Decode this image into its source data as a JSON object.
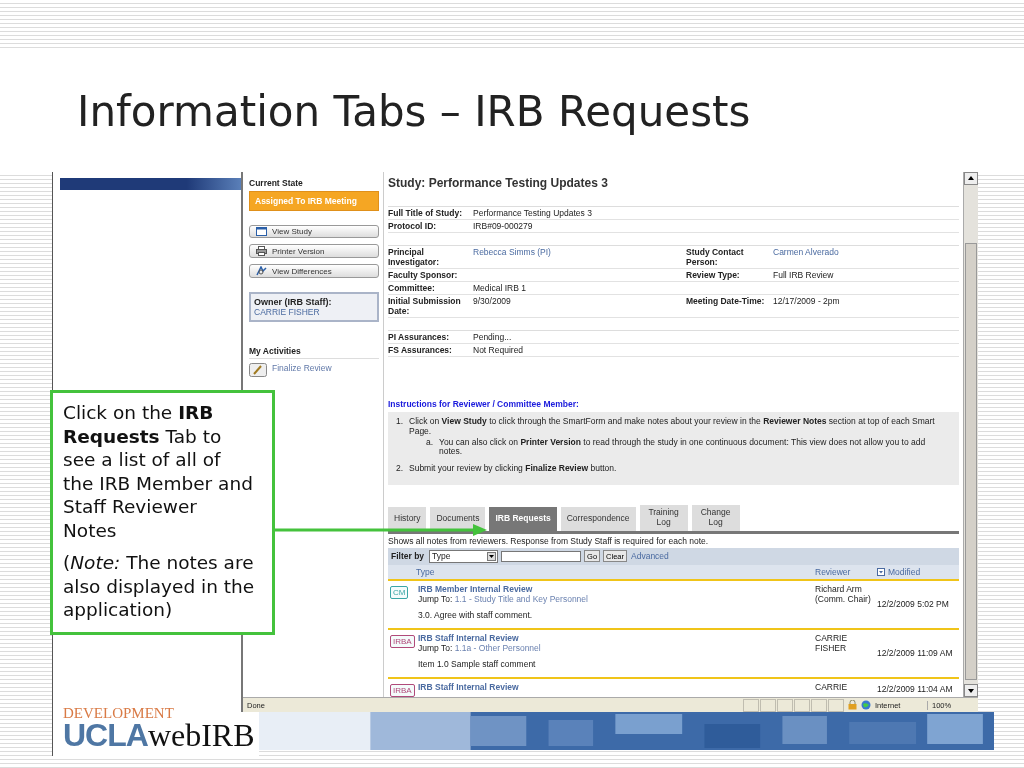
{
  "slide": {
    "title": "Information Tabs – IRB Requests"
  },
  "sidebar": {
    "state_label": "Current State",
    "state": "Assigned To IRB Meeting",
    "buttons": [
      {
        "label": "View Study",
        "kind": "window"
      },
      {
        "label": "Printer Version",
        "kind": "printer"
      },
      {
        "label": "View Differences",
        "kind": "compare"
      }
    ],
    "owner_label": "Owner (IRB Staff):",
    "owner": "CARRIE FISHER",
    "activities_label": "My Activities",
    "activities": [
      {
        "label": "Finalize Review",
        "kind": "pencil"
      }
    ]
  },
  "study": {
    "heading": "Study:  Performance Testing Updates 3",
    "groups": [
      [
        {
          "label": "Full Title of Study:",
          "value": "Performance Testing Updates 3",
          "is_link": false
        },
        {
          "label": "Protocol ID:",
          "value": "IRB#09-000279",
          "is_link": false
        }
      ],
      [
        {
          "label": "Principal Investigator:",
          "value": "Rebecca Simms (PI)",
          "is_link": true,
          "label_2": "Study Contact Person:",
          "value_2": "Carmen Alverado",
          "is_link_2": true
        },
        {
          "label": "Faculty Sponsor:",
          "label_2": "Review Type:",
          "value_2": "Full IRB Review",
          "is_link_2": false
        },
        {
          "label": "Committee:",
          "value": "Medical IRB 1",
          "is_link": false
        },
        {
          "label": "Initial Submission Date:",
          "value": "9/30/2009",
          "is_link": false,
          "label_2": "Meeting Date-Time:",
          "value_2": "12/17/2009 - 2pm",
          "is_link_2": false
        }
      ],
      [
        {
          "label": "PI Assurances:",
          "value": "Pending...",
          "is_link": false
        },
        {
          "label": "FS Assurances:",
          "value": "Not Required",
          "is_link": false
        }
      ]
    ]
  },
  "instructions": {
    "title": "Instructions for Reviewer / Committee Member:",
    "items": [
      {
        "marker": "1.",
        "text": "Click on **View Study** to click through the SmartForm and make notes about your review in the **Reviewer Notes** section at top of each Smart Page.",
        "children": [
          {
            "marker": "a.",
            "text": "You can also click on **Printer Version** to read through the study in one continuous document: This view does not allow you to add notes."
          }
        ]
      },
      {
        "marker": "2.",
        "text": "Submit your review by clicking **Finalize Review** button."
      }
    ]
  },
  "tabs": [
    {
      "label": "History",
      "selected": false
    },
    {
      "label": "Documents",
      "selected": false
    },
    {
      "label": "IRB Requests",
      "selected": true
    },
    {
      "label": "Correspondence",
      "selected": false
    },
    {
      "label": "Training Log",
      "selected": false
    },
    {
      "label": "Change Log",
      "selected": false
    }
  ],
  "notes_intro": "Shows all notes from reviewers. Response from Study Staff is required for each note.",
  "filter": {
    "label": "Filter by",
    "select": "Type",
    "buttons": [
      "Go",
      "Clear"
    ],
    "link": "Advanced"
  },
  "columns": [
    "Type",
    "Reviewer",
    "Modified"
  ],
  "notes": [
    {
      "badge": "CM",
      "color": "#3aa6a6",
      "title": "IRB Member Internal Review",
      "jump_label": "Jump To:",
      "jump_link": "1.1 - Study Title and Key Personnel",
      "comment": "3.0. Agree with staff comment.",
      "reviewer": "Richard Arm (Comm. Chair)",
      "modified": "12/2/2009 5:02 PM"
    },
    {
      "badge": "IRBA",
      "color": "#b04a7a",
      "title": "IRB Staff Internal Review",
      "jump_label": "Jump To:",
      "jump_link": "1.1a - Other Personnel",
      "comment": "Item 1.0 Sample staff comment",
      "reviewer": "CARRIE FISHER",
      "modified": "12/2/2009 11:09 AM"
    },
    {
      "badge": "IRBA",
      "color": "#b04a7a",
      "title": "IRB Staff Internal Review",
      "reviewer": "CARRIE",
      "modified": "12/2/2009 11:04 AM"
    }
  ],
  "status_bar": {
    "status": "Done",
    "zone": "Internet",
    "zoom": "100%"
  },
  "logo": {
    "top": "DEVELOPMENT",
    "brand": "UCLA",
    "product": "webIRB"
  },
  "callout": {
    "paragraphs": [
      "Click on the **IRB Requests** Tab to see a list of all of the IRB Member and Staff Reviewer Notes",
      "(*Note:* The notes are also displayed in the application)"
    ]
  }
}
